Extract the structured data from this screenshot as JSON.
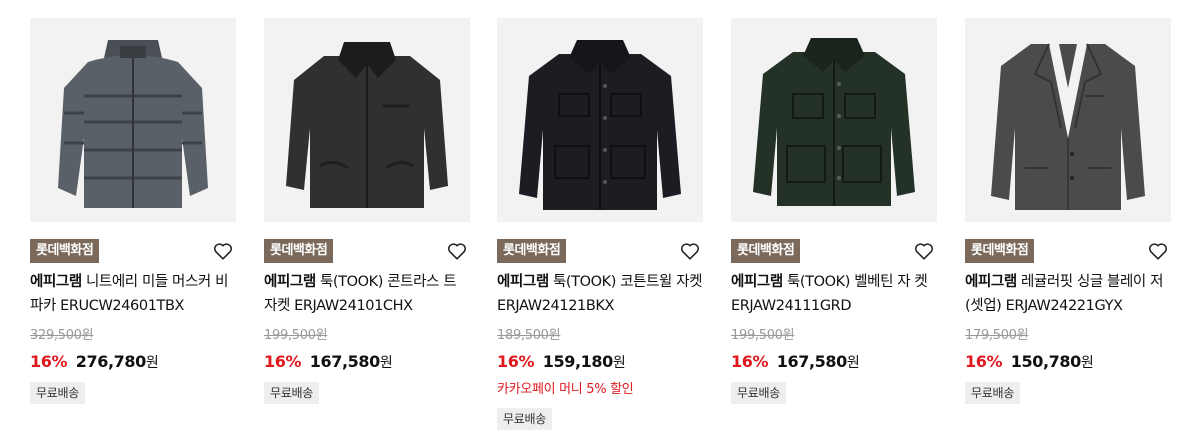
{
  "products": [
    {
      "store": "롯데백화점",
      "brand": "에피그램",
      "name": "니트에리 미들 머스커 비 파카 ERUCW24601TBX",
      "original_price": "329,500",
      "original_unit": "원",
      "discount_rate": "16%",
      "sale_price": "276,780",
      "sale_unit": "원",
      "promo": "",
      "shipping": "무료배송",
      "image": "gray-puffer-parka-photo"
    },
    {
      "store": "롯데백화점",
      "brand": "에피그램",
      "name": "툭(TOOK) 콘트라스 트 자켓 ERJAW24101CHX",
      "original_price": "199,500",
      "original_unit": "원",
      "discount_rate": "16%",
      "sale_price": "167,580",
      "sale_unit": "원",
      "promo": "",
      "shipping": "무료배송",
      "image": "charcoal-corduroy-collar-jacket-photo"
    },
    {
      "store": "롯데백화점",
      "brand": "에피그램",
      "name": "툭(TOOK) 코튼트윌 자켓 ERJAW24121BKX",
      "original_price": "189,500",
      "original_unit": "원",
      "discount_rate": "16%",
      "sale_price": "159,180",
      "sale_unit": "원",
      "promo": "카카오페이 머니 5% 할인",
      "shipping": "무료배송",
      "image": "black-cotton-twill-jacket-photo"
    },
    {
      "store": "롯데백화점",
      "brand": "에피그램",
      "name": "툭(TOOK) 벨베틴 자 켓 ERJAW24111GRD",
      "original_price": "199,500",
      "original_unit": "원",
      "discount_rate": "16%",
      "sale_price": "167,580",
      "sale_unit": "원",
      "promo": "",
      "shipping": "무료배송",
      "image": "green-velveteen-jacket-photo"
    },
    {
      "store": "롯데백화점",
      "brand": "에피그램",
      "name": "레귤러핏 싱글 블레이 저 (셋업) ERJAW24221GYX",
      "original_price": "179,500",
      "original_unit": "원",
      "discount_rate": "16%",
      "sale_price": "150,780",
      "sale_unit": "원",
      "promo": "",
      "shipping": "무료배송",
      "image": "gray-single-blazer-photo"
    }
  ],
  "colors": {
    "badge_bg": "#7b6a5b",
    "discount_red": "#e0191e",
    "image_bg": "#f2f2f2"
  }
}
